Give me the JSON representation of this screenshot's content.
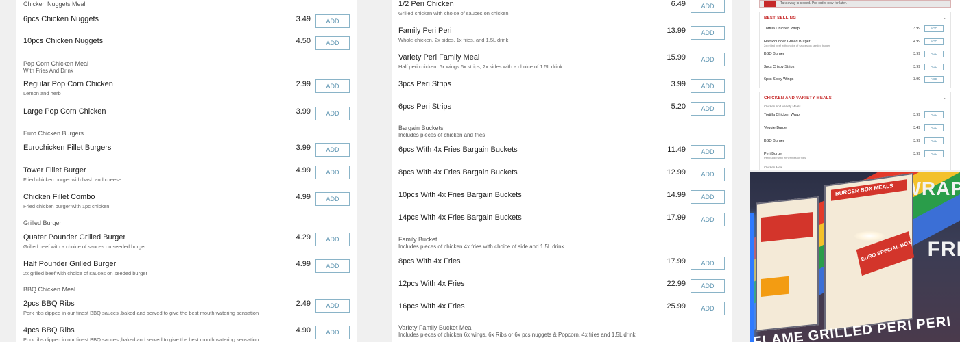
{
  "ui": {
    "add_label": "ADD"
  },
  "left_column": {
    "sections": [
      {
        "title": "Chicken Nuggets Meal",
        "subtitle": "",
        "items": [
          {
            "name": "6pcs Chicken Nuggets",
            "desc": "",
            "price": "3.49"
          },
          {
            "name": "10pcs Chicken Nuggets",
            "desc": "",
            "price": "4.50"
          }
        ]
      },
      {
        "title": "Pop Corn Chicken Meal",
        "subtitle": "With Fries And Drink",
        "items": [
          {
            "name": "Regular Pop Corn Chicken",
            "desc": "Lemon and herb",
            "price": "2.99"
          },
          {
            "name": "Large Pop Corn Chicken",
            "desc": "",
            "price": "3.99"
          }
        ]
      },
      {
        "title": "Euro Chicken Burgers",
        "subtitle": "",
        "items": [
          {
            "name": "Eurochicken Fillet Burgers",
            "desc": "",
            "price": "3.99"
          },
          {
            "name": "Tower Fillet Burger",
            "desc": "Fried chicken burger with hash and cheese",
            "price": "4.99"
          },
          {
            "name": "Chicken Fillet Combo",
            "desc": "Fried chicken burger with 1pc chicken",
            "price": "4.99"
          }
        ]
      },
      {
        "title": "Grilled Burger",
        "subtitle": "",
        "items": [
          {
            "name": "Quater Pounder Grilled Burger",
            "desc": "Grilled beef with a choice of sauces on seeded burger",
            "price": "4.29"
          },
          {
            "name": "Half Pounder Grilled Burger",
            "desc": "2x grilled beef with choice of sauces on seeded burger",
            "price": "4.99"
          }
        ]
      },
      {
        "title": "BBQ Chicken Meal",
        "subtitle": "",
        "items": [
          {
            "name": "2pcs BBQ Ribs",
            "desc": "Pork ribs dipped in our finest BBQ sauces ,baked and served to give the best mouth watering sensation",
            "price": "2.49"
          },
          {
            "name": "4pcs BBQ Ribs",
            "desc": "Pork ribs dipped in our finest BBQ sauces ,baked and served to give the best mouth watering sensation",
            "price": "4.90"
          }
        ]
      }
    ]
  },
  "middle_column": {
    "sections": [
      {
        "title": "",
        "subtitle": "",
        "items": [
          {
            "name": "1/2 Peri Chicken",
            "desc": "Grilled chicken with choice of sauces on chicken",
            "price": "6.49"
          },
          {
            "name": "Family Peri Peri",
            "desc": "Whole chicken, 2x sides, 1x fries, and 1.5L drink",
            "price": "13.99"
          },
          {
            "name": "Variety Peri Family Meal",
            "desc": "Half peri chicken, 6x wings 6x strips, 2x sides with a choice of 1.5L drink",
            "price": "15.99"
          },
          {
            "name": "3pcs Peri Strips",
            "desc": "",
            "price": "3.99"
          },
          {
            "name": "6pcs Peri Strips",
            "desc": "",
            "price": "5.20"
          }
        ]
      },
      {
        "title": "Bargain Buckets",
        "subtitle": "Includes pieces of chicken and fries",
        "items": [
          {
            "name": "6pcs With 4x Fries Bargain Buckets",
            "desc": "",
            "price": "11.49"
          },
          {
            "name": "8pcs With 4x Fries Bargain Buckets",
            "desc": "",
            "price": "12.99"
          },
          {
            "name": "10pcs With 4x Fries Bargain Buckets",
            "desc": "",
            "price": "14.99"
          },
          {
            "name": "14pcs With 4x Fries Bargain Buckets",
            "desc": "",
            "price": "17.99"
          }
        ]
      },
      {
        "title": "Family Bucket",
        "subtitle": "Includes pieces of chicken 4x fries with choice of side and 1.5L drink",
        "items": [
          {
            "name": "8pcs With 4x Fries",
            "desc": "",
            "price": "17.99"
          },
          {
            "name": "12pcs With 4x Fries",
            "desc": "",
            "price": "22.99"
          },
          {
            "name": "16pcs With 4x Fries",
            "desc": "",
            "price": "25.99"
          }
        ]
      },
      {
        "title": "Variety Family Bucket Meal",
        "subtitle": "Includes pieces of chicken 6x wings, 6x Ribs or 6x pcs nuggets & Popcorn, 4x fries and 1.5L drink",
        "items": []
      }
    ]
  },
  "phone_preview": {
    "banner": "Takeaway is closed. Pre-order now for later.",
    "best_selling": {
      "title": "BEST SELLING",
      "items": [
        {
          "name": "Tortilla Chicken Wrap",
          "desc": "",
          "price": "3.99"
        },
        {
          "name": "Half Pounder Grilled Burger",
          "desc": "2x grilled beef with choice of sauces on seeded burger",
          "price": "4.99"
        },
        {
          "name": "BBQ Burger",
          "desc": "",
          "price": "3.99"
        },
        {
          "name": "3pcs Crispy Strips",
          "desc": "",
          "price": "3.99"
        },
        {
          "name": "6pcs Spicy Wings",
          "desc": "",
          "price": "3.99"
        }
      ]
    },
    "variety": {
      "title": "CHICKEN AND VARIETY MEALS",
      "subtitle": "Chicken And Variety Meals",
      "items": [
        {
          "name": "Tortilla Chicken Wrap",
          "desc": "",
          "price": "3.99"
        },
        {
          "name": "Veggie Burger",
          "desc": "",
          "price": "3.49"
        },
        {
          "name": "BBQ Burger",
          "desc": "",
          "price": "3.99"
        },
        {
          "name": "Peri Burger",
          "desc": "Peri burger with either fries or fries",
          "price": "3.99"
        }
      ],
      "footer": "Chicken Meal"
    }
  },
  "photo": {
    "description_texts": [
      "WRAP",
      "FRI",
      "FLAME GRILLED PERI PERI",
      "EURO SPECIAL BOX",
      "BURGER BOX MEALS"
    ],
    "colors": {
      "wall": "#2b2f45",
      "poster": "#f4ead7",
      "red": "#d3352b",
      "blue": "#2f7bff"
    }
  },
  "colors": {
    "add_border": "#8ab4c8",
    "add_text": "#5b93b0",
    "accent_red": "#c62828"
  }
}
